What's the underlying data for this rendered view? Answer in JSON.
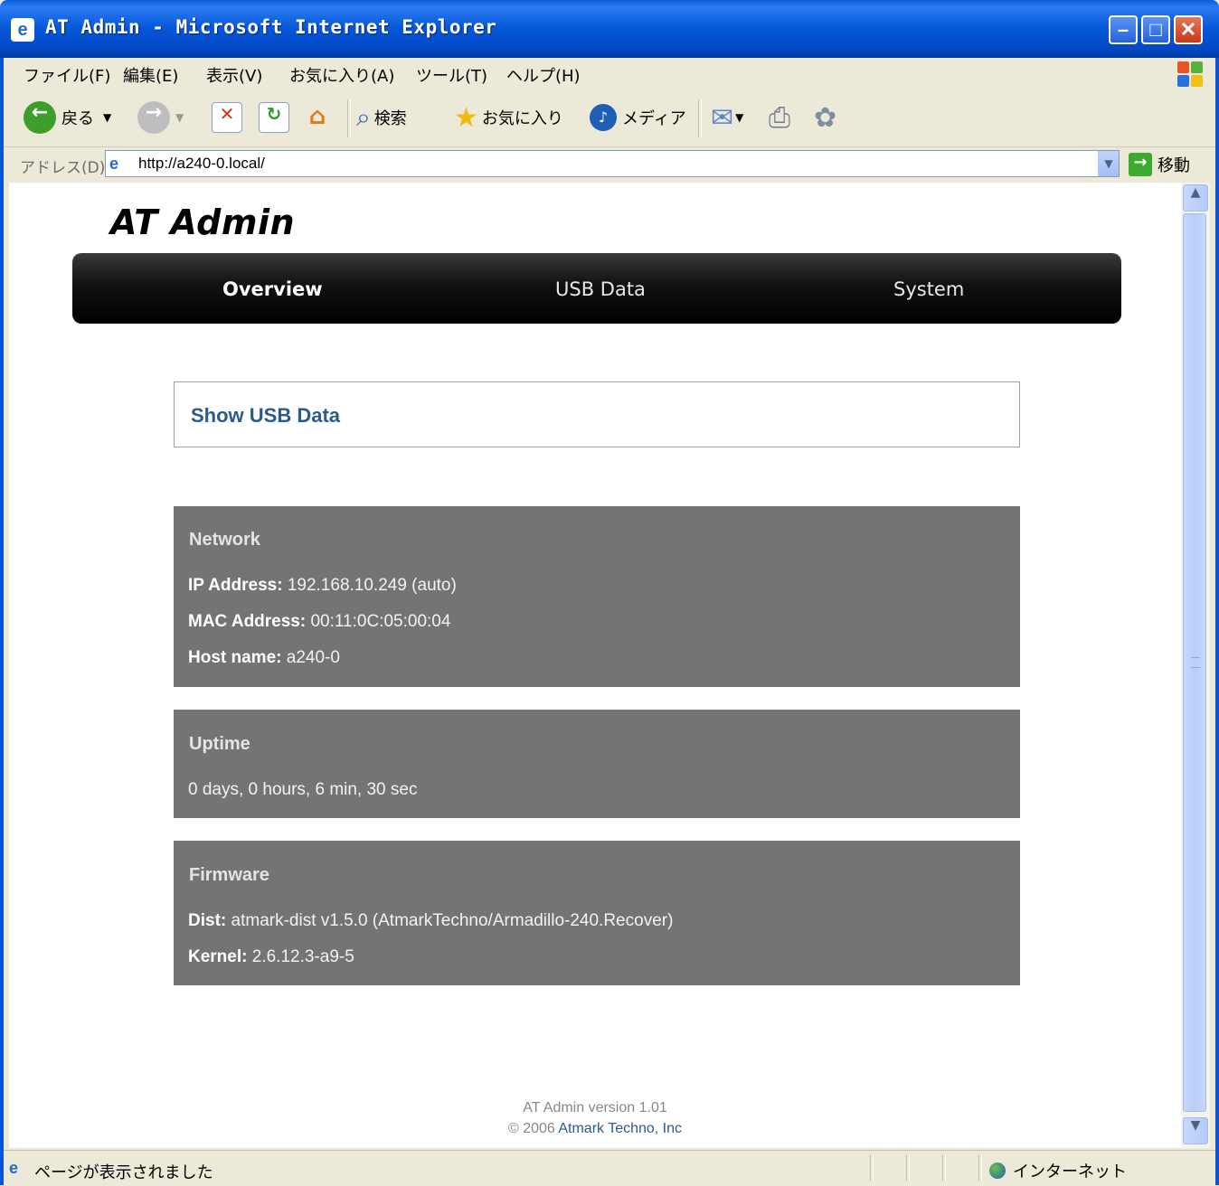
{
  "window": {
    "title": "AT Admin - Microsoft Internet Explorer",
    "minimize_glyph": "–",
    "maximize_glyph": "□",
    "close_glyph": "✕"
  },
  "menu": [
    "ファイル(F)",
    "編集(E)",
    "表示(V)",
    "お気に入り(A)",
    "ツール(T)",
    "ヘルプ(H)"
  ],
  "toolbar": {
    "back_label": "戻る",
    "search_label": "検索",
    "favorites_label": "お気に入り",
    "media_label": "メディア"
  },
  "address": {
    "label": "アドレス(D)",
    "url": "http://a240-0.local/",
    "go_label": "移動"
  },
  "page": {
    "app_title": "AT Admin",
    "nav": [
      {
        "label": "Overview",
        "active": true
      },
      {
        "label": "USB Data",
        "active": false
      },
      {
        "label": "System",
        "active": false
      }
    ],
    "show_usb_link": "Show USB Data",
    "network": {
      "heading": "Network",
      "ip_label": "IP Address:",
      "ip_value": "192.168.10.249 (auto)",
      "mac_label": "MAC Address:",
      "mac_value": "00:11:0C:05:00:04",
      "host_label": "Host name:",
      "host_value": "a240-0"
    },
    "uptime": {
      "heading": "Uptime",
      "value": "0 days, 0 hours, 6 min, 30 sec"
    },
    "firmware": {
      "heading": "Firmware",
      "dist_label": "Dist:",
      "dist_value": "atmark-dist v1.5.0 (AtmarkTechno/Armadillo-240.Recover)",
      "kernel_label": "Kernel:",
      "kernel_value": "2.6.12.3-a9-5"
    },
    "footer": {
      "version": "AT Admin version 1.01",
      "copyright": "© 2006",
      "company_link": "Atmark Techno, Inc"
    }
  },
  "status": {
    "text": "ページが表示されました",
    "zone": "インターネット"
  },
  "colors": {
    "panel_bg": "#747472",
    "link": "#2D5A8C",
    "nav_bg": "#000000"
  }
}
